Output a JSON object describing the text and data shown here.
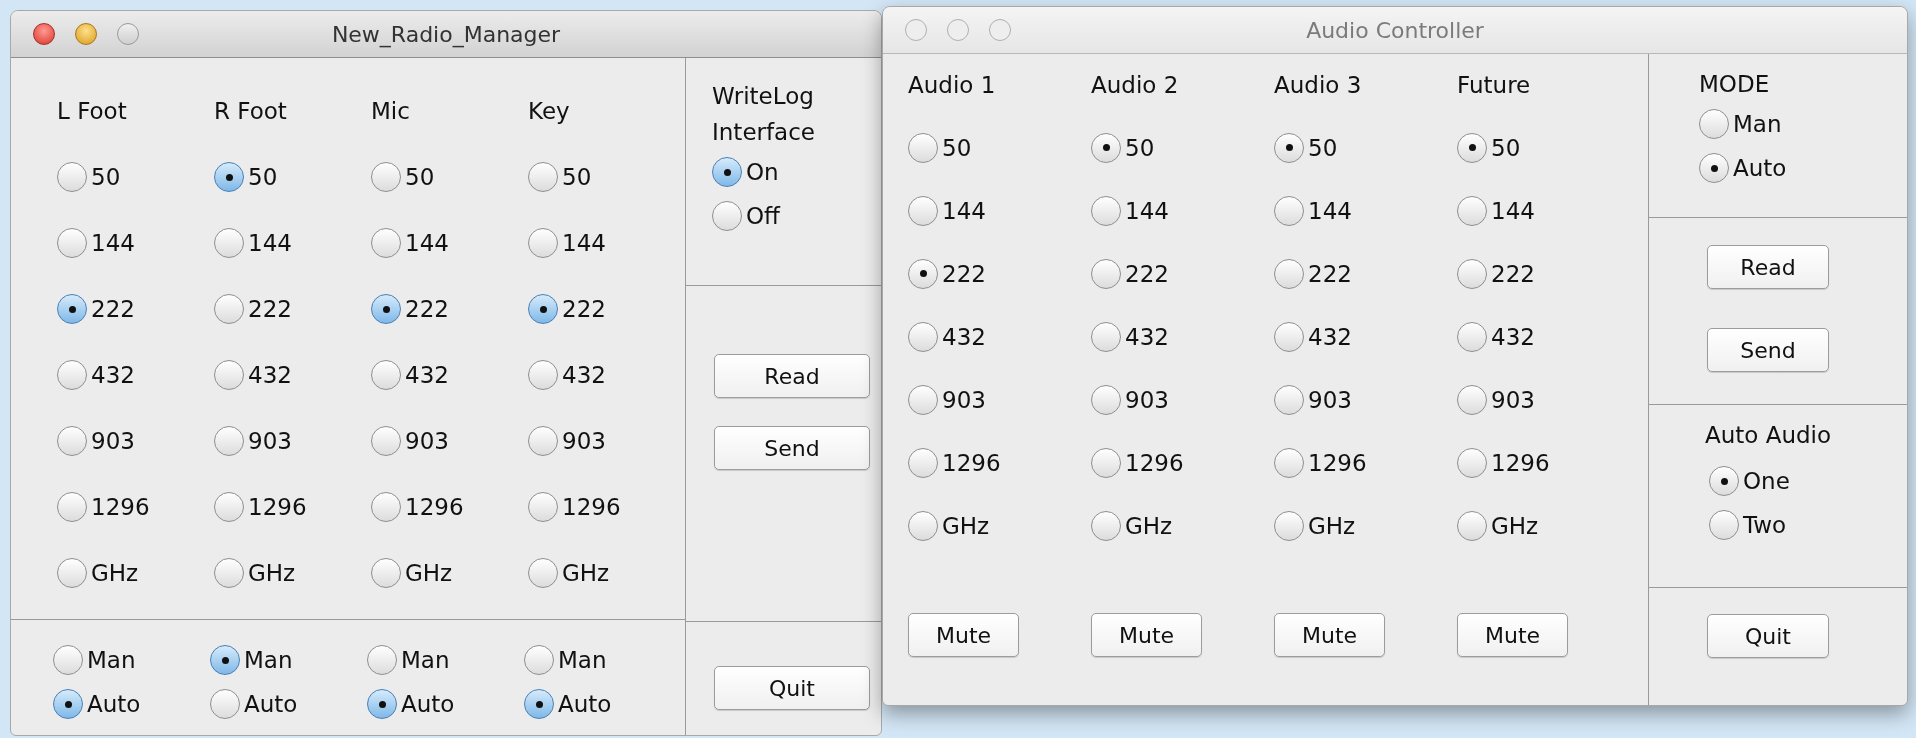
{
  "windows": [
    {
      "title": "New_Radio_Manager",
      "active": true,
      "columns": [
        {
          "header": "L Foot",
          "bands": [
            {
              "label": "50",
              "selected": false
            },
            {
              "label": "144",
              "selected": false
            },
            {
              "label": "222",
              "selected": true
            },
            {
              "label": "432",
              "selected": false
            },
            {
              "label": "903",
              "selected": false
            },
            {
              "label": "1296",
              "selected": false
            },
            {
              "label": "GHz",
              "selected": false
            }
          ],
          "modes": [
            {
              "label": "Man",
              "selected": false
            },
            {
              "label": "Auto",
              "selected": true
            }
          ]
        },
        {
          "header": "R Foot",
          "bands": [
            {
              "label": "50",
              "selected": true
            },
            {
              "label": "144",
              "selected": false
            },
            {
              "label": "222",
              "selected": false
            },
            {
              "label": "432",
              "selected": false
            },
            {
              "label": "903",
              "selected": false
            },
            {
              "label": "1296",
              "selected": false
            },
            {
              "label": "GHz",
              "selected": false
            }
          ],
          "modes": [
            {
              "label": "Man",
              "selected": true
            },
            {
              "label": "Auto",
              "selected": false
            }
          ]
        },
        {
          "header": "Mic",
          "bands": [
            {
              "label": "50",
              "selected": false
            },
            {
              "label": "144",
              "selected": false
            },
            {
              "label": "222",
              "selected": true
            },
            {
              "label": "432",
              "selected": false
            },
            {
              "label": "903",
              "selected": false
            },
            {
              "label": "1296",
              "selected": false
            },
            {
              "label": "GHz",
              "selected": false
            }
          ],
          "modes": [
            {
              "label": "Man",
              "selected": false
            },
            {
              "label": "Auto",
              "selected": true
            }
          ]
        },
        {
          "header": "Key",
          "bands": [
            {
              "label": "50",
              "selected": false
            },
            {
              "label": "144",
              "selected": false
            },
            {
              "label": "222",
              "selected": true
            },
            {
              "label": "432",
              "selected": false
            },
            {
              "label": "903",
              "selected": false
            },
            {
              "label": "1296",
              "selected": false
            },
            {
              "label": "GHz",
              "selected": false
            }
          ],
          "modes": [
            {
              "label": "Man",
              "selected": false
            },
            {
              "label": "Auto",
              "selected": true
            }
          ]
        }
      ],
      "side": [
        {
          "kind": "radio-group",
          "title": "WriteLog Interface",
          "options": [
            {
              "label": "On",
              "selected": true
            },
            {
              "label": "Off",
              "selected": false
            }
          ]
        },
        {
          "kind": "buttons",
          "buttons": [
            "Read",
            "Send"
          ]
        },
        {
          "kind": "buttons",
          "buttons": [
            "Quit"
          ]
        }
      ]
    },
    {
      "title": "Audio Controller",
      "active": false,
      "columns": [
        {
          "header": "Audio 1",
          "bands": [
            {
              "label": "50",
              "selected": false
            },
            {
              "label": "144",
              "selected": false
            },
            {
              "label": "222",
              "selected": true
            },
            {
              "label": "432",
              "selected": false
            },
            {
              "label": "903",
              "selected": false
            },
            {
              "label": "1296",
              "selected": false
            },
            {
              "label": "GHz",
              "selected": false
            }
          ],
          "button": "Mute"
        },
        {
          "header": "Audio 2",
          "bands": [
            {
              "label": "50",
              "selected": true
            },
            {
              "label": "144",
              "selected": false
            },
            {
              "label": "222",
              "selected": false
            },
            {
              "label": "432",
              "selected": false
            },
            {
              "label": "903",
              "selected": false
            },
            {
              "label": "1296",
              "selected": false
            },
            {
              "label": "GHz",
              "selected": false
            }
          ],
          "button": "Mute"
        },
        {
          "header": "Audio 3",
          "bands": [
            {
              "label": "50",
              "selected": true
            },
            {
              "label": "144",
              "selected": false
            },
            {
              "label": "222",
              "selected": false
            },
            {
              "label": "432",
              "selected": false
            },
            {
              "label": "903",
              "selected": false
            },
            {
              "label": "1296",
              "selected": false
            },
            {
              "label": "GHz",
              "selected": false
            }
          ],
          "button": "Mute"
        },
        {
          "header": "Future",
          "bands": [
            {
              "label": "50",
              "selected": true
            },
            {
              "label": "144",
              "selected": false
            },
            {
              "label": "222",
              "selected": false
            },
            {
              "label": "432",
              "selected": false
            },
            {
              "label": "903",
              "selected": false
            },
            {
              "label": "1296",
              "selected": false
            },
            {
              "label": "GHz",
              "selected": false
            }
          ],
          "button": "Mute"
        }
      ],
      "side": [
        {
          "kind": "radio-group",
          "title": "MODE",
          "options": [
            {
              "label": "Man",
              "selected": false
            },
            {
              "label": "Auto",
              "selected": true
            }
          ]
        },
        {
          "kind": "buttons",
          "buttons": [
            "Read",
            "Send"
          ]
        },
        {
          "kind": "radio-group",
          "title": "Auto Audio",
          "options": [
            {
              "label": "One",
              "selected": true
            },
            {
              "label": "Two",
              "selected": false
            }
          ]
        },
        {
          "kind": "buttons",
          "buttons": [
            "Quit"
          ]
        }
      ]
    }
  ]
}
